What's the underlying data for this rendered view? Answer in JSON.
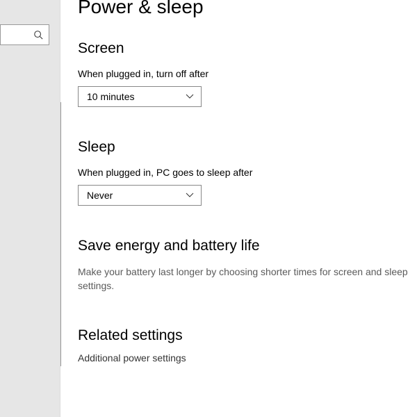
{
  "page_title": "Power & sleep",
  "search": {
    "placeholder": ""
  },
  "screen": {
    "heading": "Screen",
    "label": "When plugged in, turn off after",
    "value": "10 minutes"
  },
  "sleep": {
    "heading": "Sleep",
    "label": "When plugged in, PC goes to sleep after",
    "value": "Never"
  },
  "energy": {
    "heading": "Save energy and battery life",
    "text": "Make your battery last longer by choosing shorter times for screen and sleep settings."
  },
  "related": {
    "heading": "Related settings",
    "link": "Additional power settings"
  }
}
